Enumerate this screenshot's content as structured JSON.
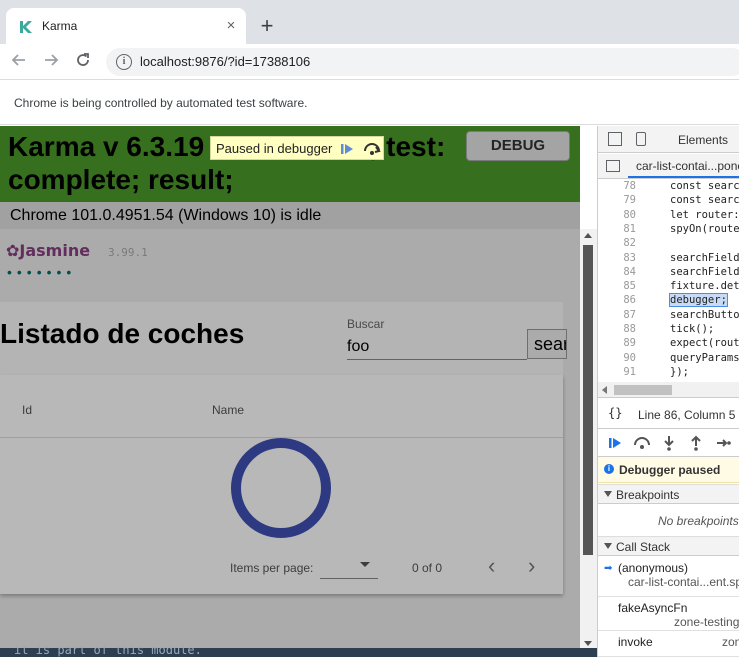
{
  "browser": {
    "tab_title": "Karma",
    "tab_close": "×",
    "new_tab": "+",
    "url": "localhost:9876/?id=17388106",
    "infobar_text": "Chrome is being controlled by automated test software."
  },
  "karma": {
    "heading": "Karma v 6.3.19 - connected; test: complete; result;",
    "debug_label": "DEBUG",
    "paused_label": "Paused in debugger",
    "status": "Chrome 101.0.4951.54 (Windows 10) is idle"
  },
  "jasmine": {
    "logo": "✿Jasmine",
    "version": "3.99.1",
    "dots": "•••••••"
  },
  "app": {
    "title": "Listado de coches",
    "search_label": "Buscar",
    "search_value": "foo",
    "search_button": "search",
    "col_id": "Id",
    "col_name": "Name",
    "items_per_page": "Items per page:",
    "range": "0 of 0",
    "prev": "‹",
    "next": "›",
    "bottom_code": "it is part of this module."
  },
  "devtools": {
    "elements_tab": "Elements",
    "file_tab": "car-list-contai...ponent.spec.ts",
    "position": "Line 86, Column 5",
    "brackets": "{}",
    "debugger_paused": "Debugger paused",
    "breakpoints_title": "Breakpoints",
    "no_breakpoints": "No breakpoints",
    "callstack_title": "Call Stack",
    "code_lines": [
      {
        "n": "78",
        "t": "const searchField"
      },
      {
        "n": "79",
        "t": "const searchButton"
      },
      {
        "n": "80",
        "t": "let router: Router"
      },
      {
        "n": "81",
        "t": "spyOn(router, 'navigate')"
      },
      {
        "n": "82",
        "t": ""
      },
      {
        "n": "83",
        "t": "searchField.value"
      },
      {
        "n": "84",
        "t": "searchField.dispatch"
      },
      {
        "n": "85",
        "t": "fixture.detectChanges"
      },
      {
        "n": "86",
        "t": "debugger;"
      },
      {
        "n": "87",
        "t": "searchButton.click"
      },
      {
        "n": "88",
        "t": "tick();"
      },
      {
        "n": "89",
        "t": "expect(router.navigate"
      },
      {
        "n": "90",
        "t": "  queryParams"
      },
      {
        "n": "91",
        "t": "});"
      }
    ],
    "callstack": [
      {
        "fn": "(anonymous)",
        "loc": "car-list-contai...ent.spec.ts"
      },
      {
        "fn": "fakeAsyncFn",
        "loc": "zone-testing.js"
      },
      {
        "fn": "invoke",
        "loc": "zone.js"
      }
    ]
  }
}
